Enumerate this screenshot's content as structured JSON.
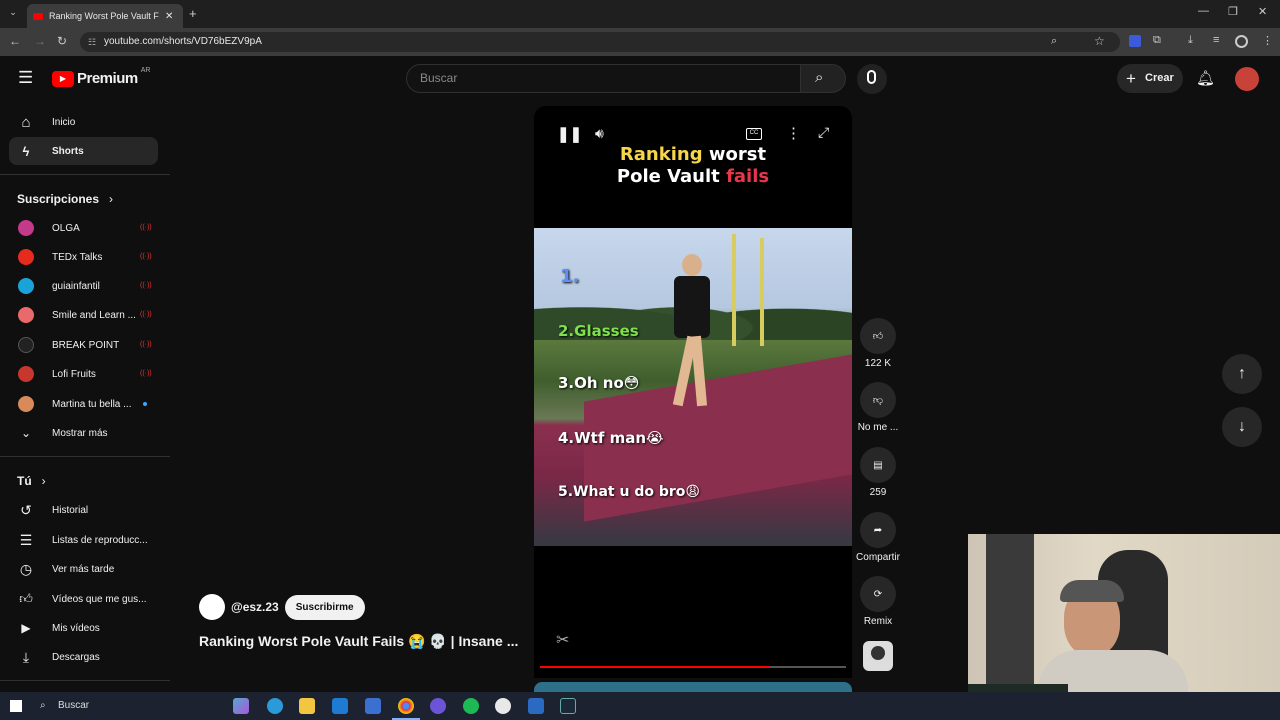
{
  "browser": {
    "tab_title": "Ranking Worst Pole Vault F",
    "url": "youtube.com/shorts/VD76bEZV9pA"
  },
  "header": {
    "logo": "Premium",
    "region": "AR",
    "search_placeholder": "Buscar",
    "create_label": "Crear"
  },
  "sidebar": {
    "top": [
      {
        "label": "Inicio",
        "icon": "home-icon"
      },
      {
        "label": "Shorts",
        "icon": "shorts-icon"
      }
    ],
    "subs_title": "Suscripciones",
    "subs": [
      {
        "label": "OLGA",
        "color": "#c33a8a"
      },
      {
        "label": "TEDx Talks",
        "color": "#e62b1e"
      },
      {
        "label": "guiainfantil",
        "color": "#1aa3d9"
      },
      {
        "label": "Smile and Learn ...",
        "color": "#e86a6a"
      },
      {
        "label": "BREAK POINT",
        "color": "#222222"
      },
      {
        "label": "Lofi Fruits",
        "color": "#c8372d"
      },
      {
        "label": "Martina tu bella ...",
        "color": "#d88a5a"
      }
    ],
    "show_more": "Mostrar más",
    "you_title": "Tú",
    "you": [
      {
        "label": "Historial",
        "icon": "history-icon"
      },
      {
        "label": "Listas de reproducc...",
        "icon": "playlist-icon"
      },
      {
        "label": "Ver más tarde",
        "icon": "clock-icon"
      },
      {
        "label": "Vídeos que me gus...",
        "icon": "like-icon"
      },
      {
        "label": "Mis vídeos",
        "icon": "video-icon"
      },
      {
        "label": "Descargas",
        "icon": "download-icon"
      }
    ]
  },
  "video": {
    "overlay_title_a": "Ranking",
    "overlay_title_b": "worst",
    "overlay_title_c": "Pole Vault",
    "overlay_title_d": "fails",
    "ranks": [
      "1.",
      "2.Glasses",
      "3.Oh no😳",
      "4.Wtf man😭",
      "5.What u do bro😩"
    ],
    "progress": 0.75
  },
  "actions": {
    "likes": "122 K",
    "dislike": "No me ...",
    "comments": "259",
    "share": "Compartir",
    "remix": "Remix"
  },
  "channel": {
    "handle": "@esz.23",
    "subscribe": "Suscribirme",
    "caption": "Ranking Worst Pole Vault Fails 😭 💀 | Insane ..."
  },
  "taskbar": {
    "search": "Buscar"
  },
  "colors": {
    "accent_red": "#ff0000",
    "title_yellow": "#f6d64a",
    "title_red": "#e8364a",
    "rank_green": "#7ee04a"
  }
}
